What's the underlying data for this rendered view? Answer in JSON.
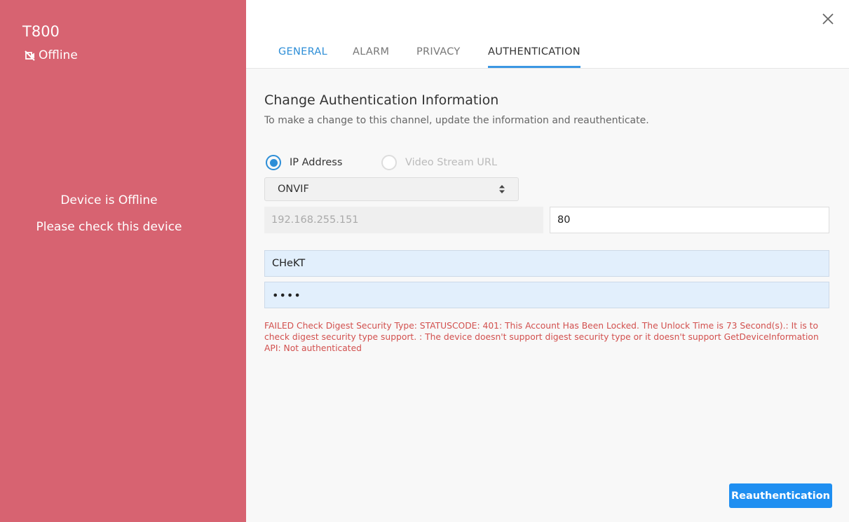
{
  "device": {
    "name": "T800",
    "status": "Offline",
    "status_icon": "no-video-icon",
    "offline_title": "Device is Offline",
    "offline_hint": "Please check this device"
  },
  "tabs": [
    {
      "label": "GENERAL"
    },
    {
      "label": "ALARM"
    },
    {
      "label": "PRIVACY"
    },
    {
      "label": "AUTHENTICATION",
      "active": true
    }
  ],
  "form": {
    "title": "Change Authentication Information",
    "description": "To make a change to this channel, update the information and reauthenticate.",
    "radio_ip_label": "IP Address",
    "radio_url_label": "Video Stream URL",
    "selected_mode": "IP Address",
    "protocol": "ONVIF",
    "ip_address": "192.168.255.151",
    "port": "80",
    "username": "CHeKT",
    "password_mask": "••••",
    "error": "FAILED Check Digest Security Type: STATUSCODE: 401: This Account Has Been Locked. The Unlock Time is 73 Second(s).: It is to check digest security type support. : The device doesn't support digest security type or it doesn't support GetDeviceInformation API: Not authenticated",
    "submit_label": "Reauthentication"
  },
  "colors": {
    "sidebar": "#d76371",
    "accent": "#2d8ed7",
    "button": "#1f8ff1",
    "error": "#d2504e"
  }
}
